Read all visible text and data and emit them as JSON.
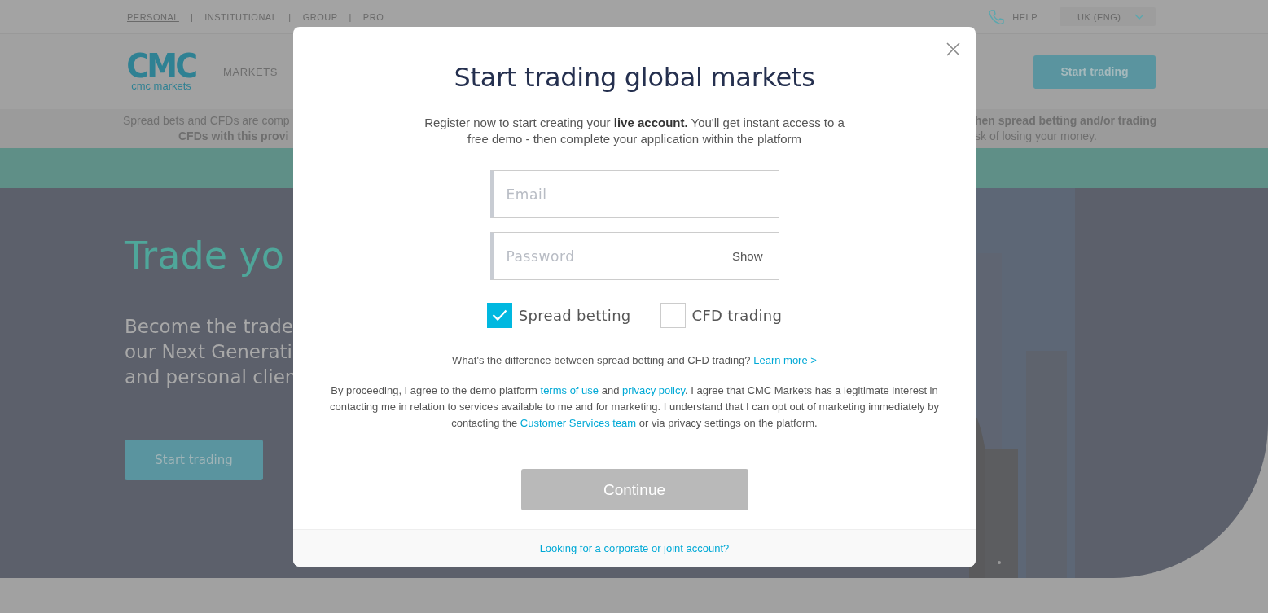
{
  "top_nav": {
    "links": [
      {
        "label": "PERSONAL",
        "selected": true
      },
      {
        "label": "INSTITUTIONAL",
        "selected": false
      },
      {
        "label": "GROUP",
        "selected": false
      },
      {
        "label": "PRO",
        "selected": false
      }
    ],
    "separators": [
      "|",
      "|",
      "|"
    ],
    "help": "HELP",
    "region": "UK (ENG)"
  },
  "header": {
    "logo": {
      "mark": "CMC",
      "text": "cmc markets"
    },
    "nav": [
      "MARKETS"
    ],
    "cta": "Start trading"
  },
  "risk_warning": {
    "left_lines": [
      {
        "text": "Spread bets and CFDs are comp",
        "bold": false
      },
      {
        "text": "CFDs with this provi",
        "bold": true
      }
    ],
    "right_lines": [
      {
        "text": "hen spread betting and/or trading",
        "bold": true
      },
      {
        "text": "sk of losing your money.",
        "bold": false
      }
    ]
  },
  "hero": {
    "title": "Trade yo",
    "subtitle_lines": [
      "Become the trade",
      "our Next Generati",
      "and personal clien"
    ],
    "cta": "Start trading",
    "background": {
      "kind": "picture"
    }
  },
  "modal": {
    "title": "Start trading global markets",
    "intro": "Register now to start creating your **live account.** You'll get instant access to a free demo - then complete your application within the platform",
    "fields": [
      {
        "kind": "email",
        "placeholder": "Email"
      },
      {
        "kind": "password",
        "placeholder": "Password",
        "toggle": "Show"
      }
    ],
    "options": [
      {
        "label": "Spread betting",
        "checked": true
      },
      {
        "label": "CFD trading",
        "checked": false
      }
    ],
    "difference": {
      "text": "What's the difference between spread betting and CFD trading?",
      "link": "Learn more >"
    },
    "legal": [
      {
        "kind": "text",
        "text": "By proceeding, I agree to the demo platform "
      },
      {
        "kind": "link",
        "text": "terms of use"
      },
      {
        "kind": "text",
        "text": " and "
      },
      {
        "kind": "link",
        "text": "privacy policy"
      },
      {
        "kind": "text",
        "text": ". I agree that CMC Markets has a legitimate interest in contacting me in relation to services available to me and for marketing. I understand that I can opt out of marketing immediately by contacting the "
      },
      {
        "kind": "link",
        "text": "Customer Services team"
      },
      {
        "kind": "text",
        "text": " or via privacy settings on the platform."
      }
    ],
    "continue": {
      "label": "Continue",
      "disabled": true
    },
    "footer_link": "Looking for a corporate or joint account?"
  }
}
